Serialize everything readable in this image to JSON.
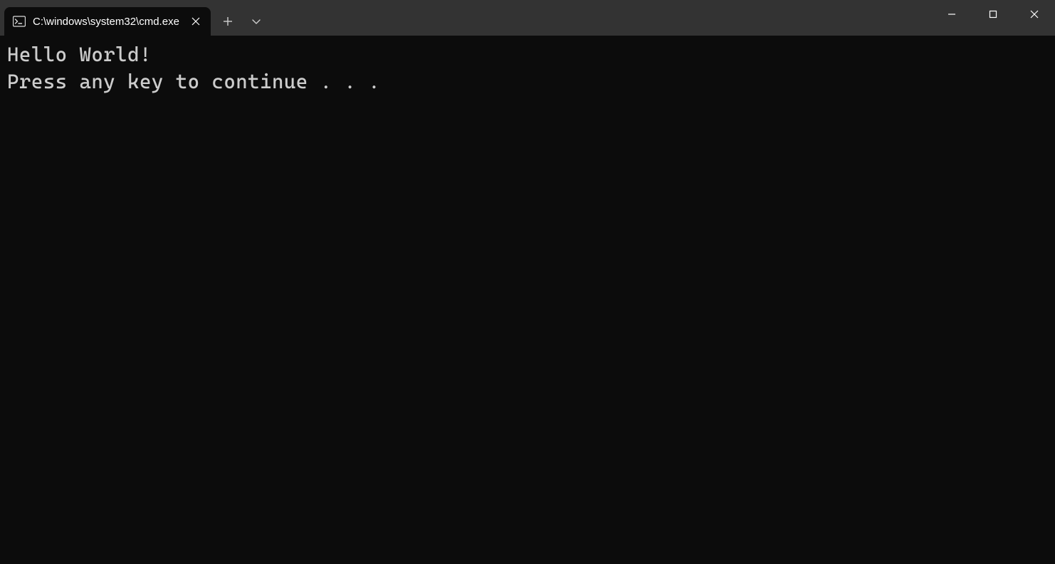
{
  "tab": {
    "title": "C:\\windows\\system32\\cmd.exe",
    "icon": "cmd-icon"
  },
  "terminal": {
    "lines": [
      "Hello World!",
      "Press any key to continue . . ."
    ]
  }
}
